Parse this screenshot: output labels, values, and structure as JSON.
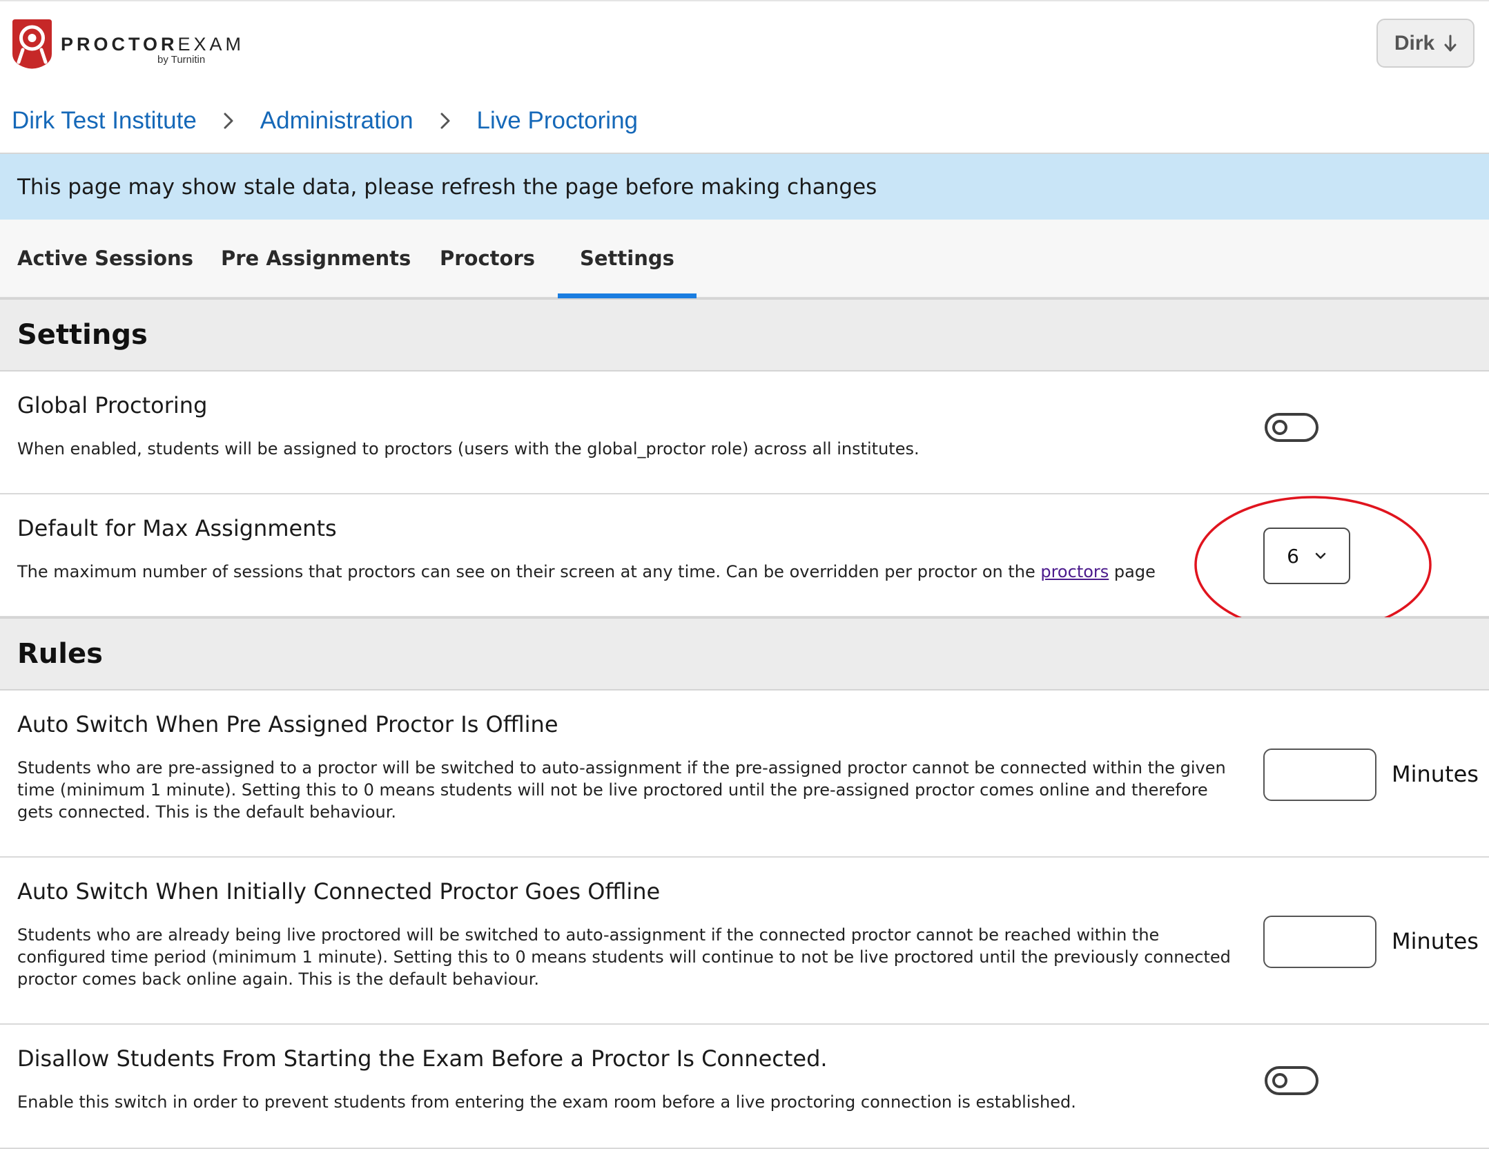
{
  "header": {
    "brand_bold": "PROCTOR",
    "brand_light": "EXAM",
    "brand_sub": "by Turnitin",
    "logo_icon": "proctorexam-logo-icon",
    "user_button": {
      "label": "Dirk",
      "icon": "arrow-down-icon"
    }
  },
  "breadcrumb": {
    "items": [
      "Dirk Test Institute",
      "Administration",
      "Live Proctoring"
    ],
    "separator_icon": "chevron-right-icon"
  },
  "notice": {
    "text": "This page may show stale data, please refresh the page before making changes"
  },
  "tabs": {
    "items": [
      "Active Sessions",
      "Pre Assignments",
      "Proctors",
      "Settings"
    ],
    "active": "Settings",
    "accent_color": "#1a7de0"
  },
  "settings_section": {
    "title": "Settings",
    "global_proctoring": {
      "title": "Global Proctoring",
      "description": "When enabled, students will be assigned to proctors (users with the global_proctor role) across all institutes.",
      "enabled": false
    },
    "max_assignments": {
      "title": "Default for Max Assignments",
      "description_before": "The maximum number of sessions that proctors can see on their screen at any time. Can be overridden per proctor on the ",
      "link_text": "proctors",
      "description_after": " page",
      "value": "6",
      "highlight_color": "#e0141e"
    }
  },
  "rules_section": {
    "title": "Rules",
    "auto_switch_preassigned": {
      "title": "Auto Switch When Pre Assigned Proctor Is Offline",
      "description": "Students who are pre-assigned to a proctor will be switched to auto-assignment if the pre-assigned proctor cannot be connected within the given time (minimum 1 minute). Setting this to 0 means students will not be live proctored until the pre-assigned proctor comes online and therefore gets connected. This is the default behaviour.",
      "value": "",
      "unit": "Minutes"
    },
    "auto_switch_connected": {
      "title": "Auto Switch When Initially Connected Proctor Goes Offline",
      "description": "Students who are already being live proctored will be switched to auto-assignment if the connected proctor cannot be reached within the configured time period (minimum 1 minute). Setting this to 0 means students will continue to not be live proctored until the previously connected proctor comes back online again. This is the default behaviour.",
      "value": "",
      "unit": "Minutes"
    },
    "disallow_start": {
      "title": "Disallow Students From Starting the Exam Before a Proctor Is Connected.",
      "description": "Enable this switch in order to prevent students from entering the exam room before a live proctoring connection is established.",
      "enabled": false
    }
  }
}
